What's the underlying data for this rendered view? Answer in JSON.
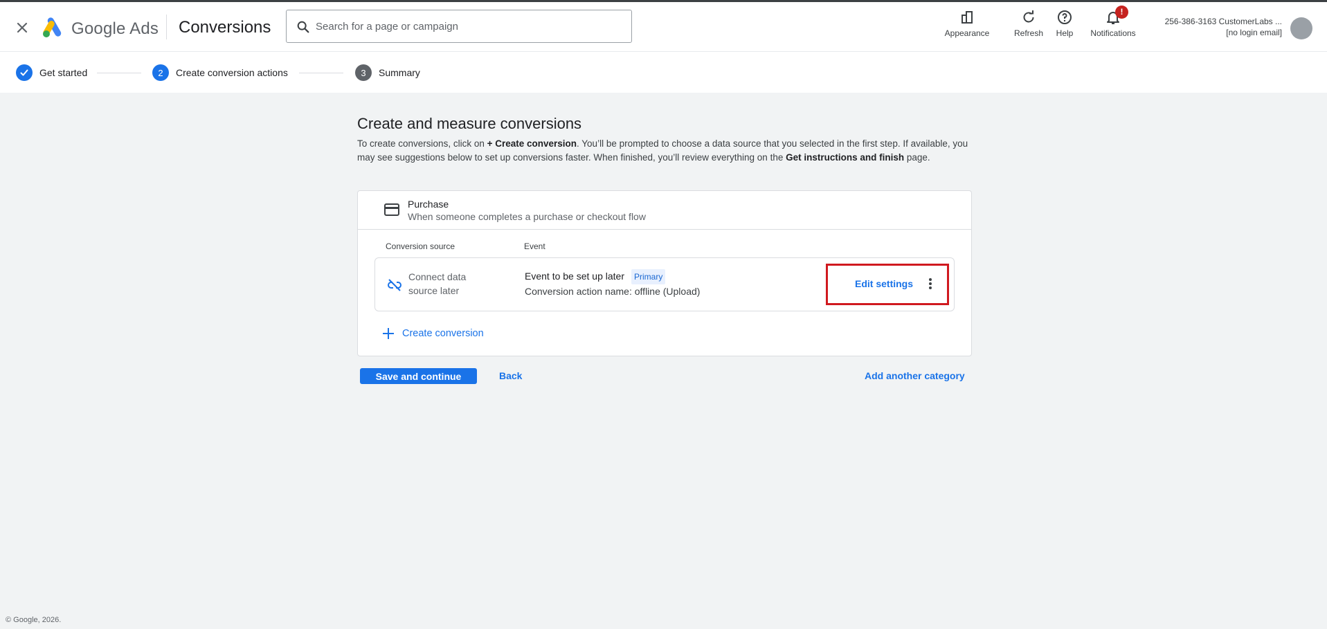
{
  "app": {
    "brand": "Google Ads",
    "page_title": "Conversions",
    "colors": {
      "accent": "#1a73e8",
      "highlight": "#d0191f",
      "notif_badge": "#c5221f"
    }
  },
  "search": {
    "placeholder": "Search for a page or campaign",
    "value": ""
  },
  "toolbar": {
    "appearance": "Appearance",
    "refresh": "Refresh",
    "help": "Help",
    "notifications": "Notifications",
    "notification_badge": "!"
  },
  "account": {
    "id_name": "256-386-3163 CustomerLabs ...",
    "email": "[no login email]"
  },
  "stepper": {
    "steps": [
      {
        "label": "Get started",
        "state": "done",
        "number": ""
      },
      {
        "label": "Create conversion actions",
        "state": "active",
        "number": "2"
      },
      {
        "label": "Summary",
        "state": "pending",
        "number": "3"
      }
    ]
  },
  "main": {
    "heading": "Create and measure conversions",
    "desc_pre": "To create conversions, click on ",
    "desc_bold1": "+ Create conversion",
    "desc_mid": ". You’ll be prompted to choose a data source that you selected in the first step. If available, you may see suggestions below to set up conversions faster. When finished, you’ll review everything on the ",
    "desc_bold2": "Get instructions and finish",
    "desc_post": " page."
  },
  "category": {
    "title": "Purchase",
    "subtitle": "When someone completes a purchase or checkout flow",
    "col_source": "Conversion source",
    "col_event": "Event",
    "rows": [
      {
        "source": "Connect data source later",
        "event_title": "Event to be set up later",
        "badge": "Primary",
        "event_sub": "Conversion action name: offline (Upload)",
        "edit_label": "Edit settings"
      }
    ],
    "create_label": "Create conversion"
  },
  "actions": {
    "save_continue": "Save and continue",
    "back": "Back",
    "add_category": "Add another category"
  },
  "footer": {
    "copyright": "© Google, 2026."
  }
}
